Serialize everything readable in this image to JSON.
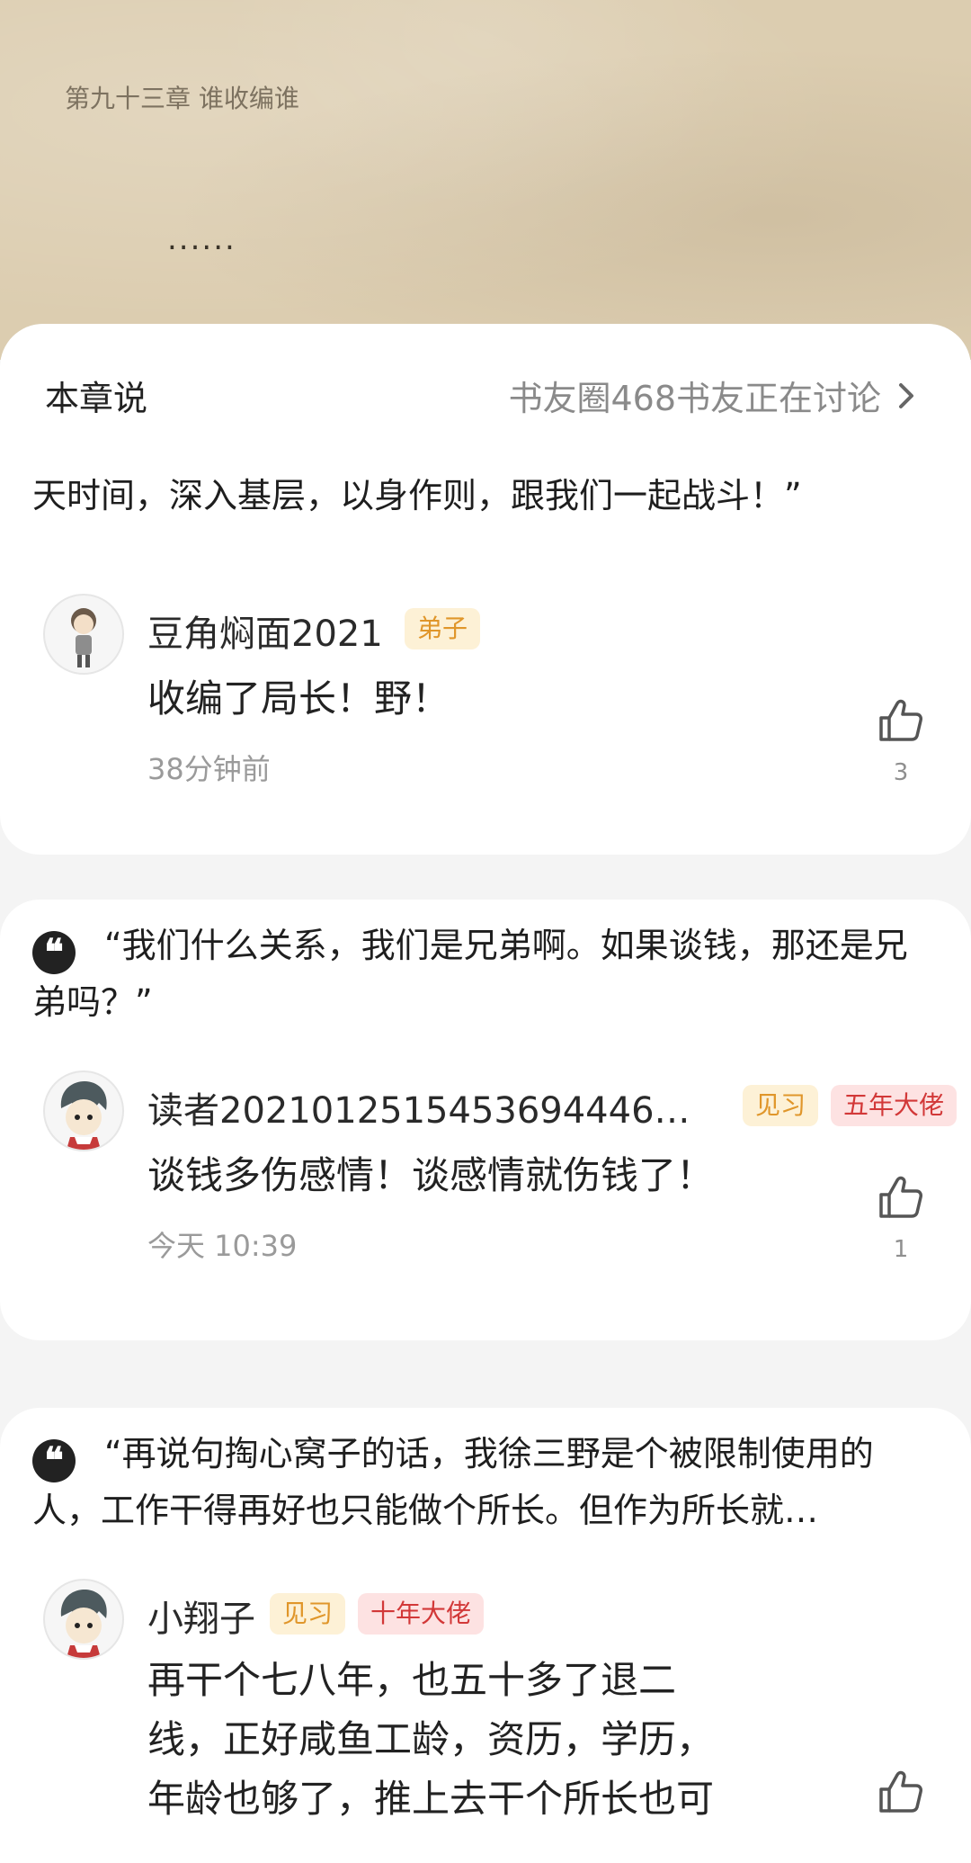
{
  "reader": {
    "chapter_title": "第九十三章 谁收编谁",
    "ellipsis": "......"
  },
  "panel": {
    "title": "本章说",
    "right_label": "书友圈468书友正在讨论"
  },
  "quote_1_tail": "天时间，深入基层，以身作则，跟我们一起战斗！”",
  "comment_1": {
    "username": "豆角焖面2021",
    "badge": "弟子",
    "text": "收编了局长！野！",
    "time": "38分钟前",
    "likes": "3"
  },
  "quote_2": "“我们什么关系，我们是兄弟啊。如果谈钱，那还是兄弟吗？”",
  "comment_2": {
    "username": "读者2021012515453694446…",
    "badge_1": "见习",
    "badge_2": "五年大佬",
    "text": "谈钱多伤感情！谈感情就伤钱了！",
    "time": "今天 10:39",
    "likes": "1"
  },
  "quote_3": "“再说句掏心窝子的话，我徐三野是个被限制使用的人，工作干得再好也只能做个所长。但作为所长就…",
  "comment_3": {
    "username": "小翔子",
    "badge_1": "见习",
    "badge_2": "十年大佬",
    "text_lines": [
      "再干个七八年，也五十多了退二",
      "线，正好咸鱼工龄，资历，学历，",
      "年龄也够了，推上去干个所长也可"
    ]
  }
}
